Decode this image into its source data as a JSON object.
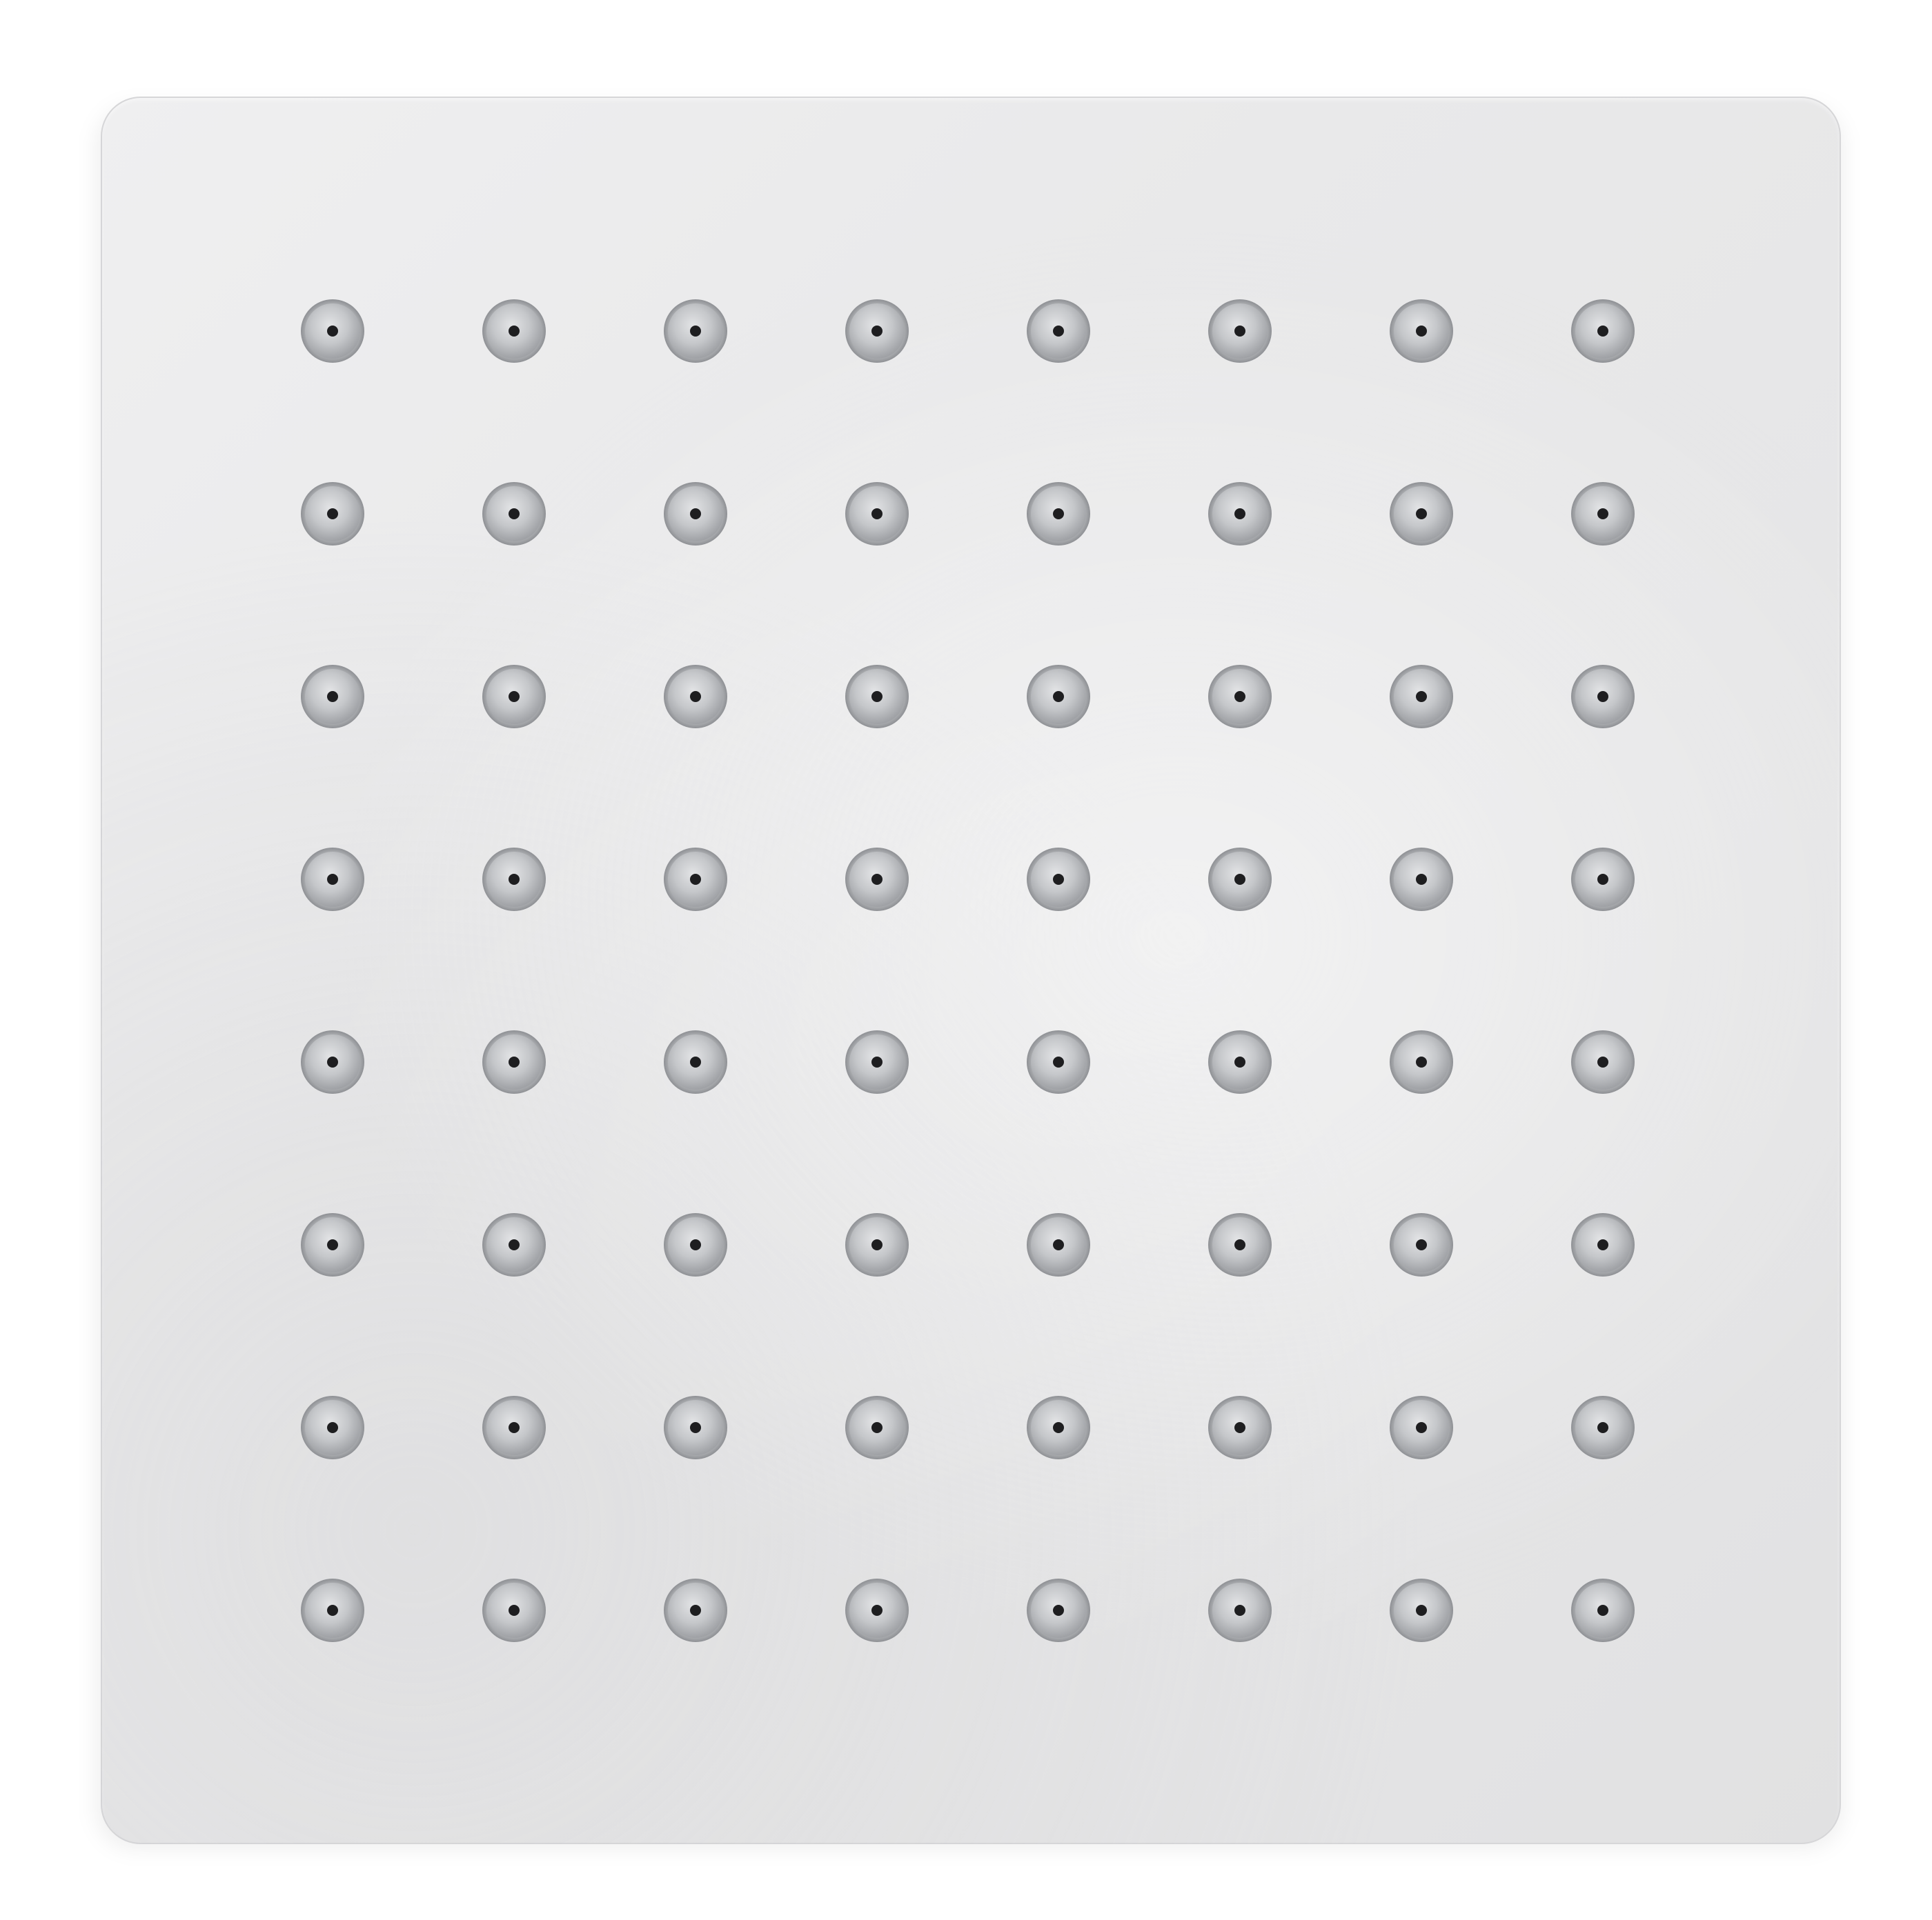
{
  "scene": {
    "plate_color": "#e8e8e9",
    "nozzle_rim_color": "#a9abae",
    "nozzle_face_color": "#c4c6c9",
    "nozzle_hole_color": "#1e1e20"
  },
  "nozzle_grid": {
    "rows": 8,
    "cols": 8
  }
}
